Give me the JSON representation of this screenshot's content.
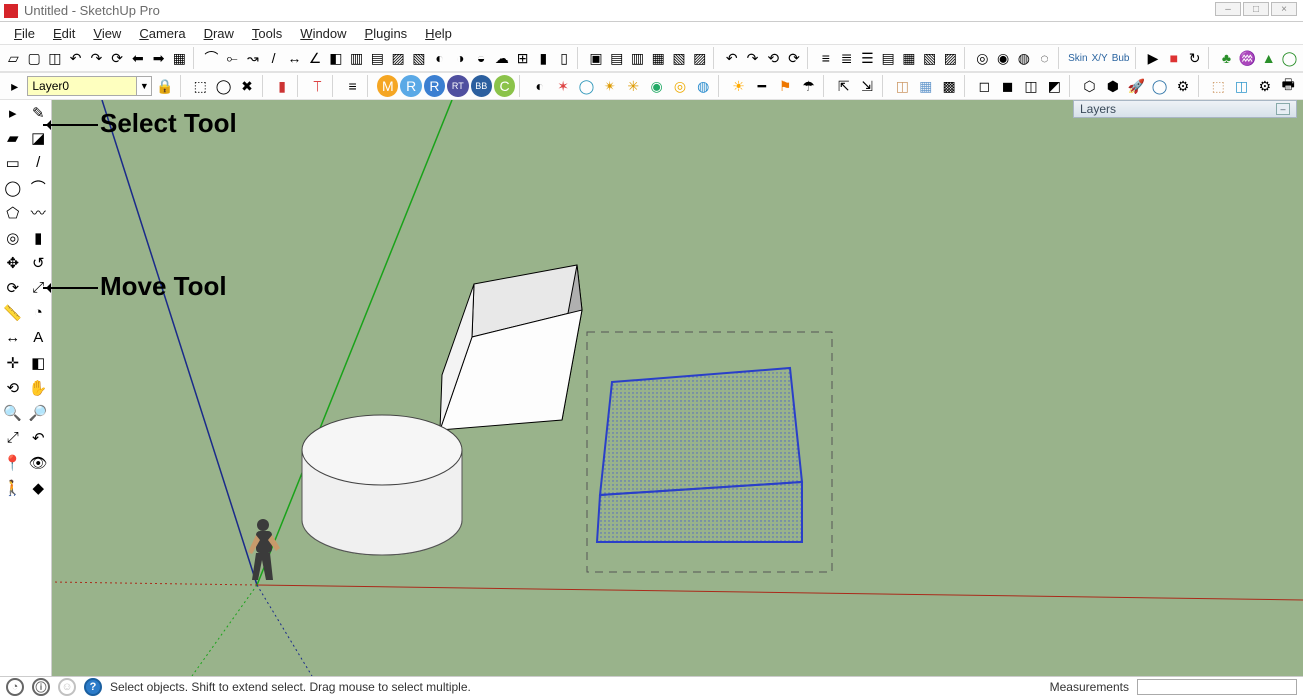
{
  "window": {
    "title": "Untitled - SketchUp Pro",
    "buttons": {
      "min": "–",
      "max": "□",
      "close": "×"
    }
  },
  "menu": [
    "File",
    "Edit",
    "View",
    "Camera",
    "Draw",
    "Tools",
    "Window",
    "Plugins",
    "Help"
  ],
  "layer_field": {
    "value": "Layer0"
  },
  "layers_panel": {
    "title": "Layers"
  },
  "status": {
    "hint": "Select objects. Shift to extend select. Drag mouse to select multiple.",
    "measurements_label": "Measurements",
    "measurements_value": ""
  },
  "annotations": {
    "select_tool": "Select Tool",
    "move_tool": "Move Tool"
  },
  "toolbar_row1_labels": [
    "Skin",
    "X/Y",
    "Bub"
  ],
  "left_tools": [
    [
      "select-tool",
      "▸",
      "make-component-tool",
      "✎"
    ],
    [
      "paint-bucket-tool",
      "▰",
      "eraser-tool",
      "◪"
    ],
    [
      "rectangle-tool",
      "▭",
      "line-tool",
      "/"
    ],
    [
      "circle-tool",
      "◯",
      "arc-tool",
      "⌒"
    ],
    [
      "polygon-tool",
      "⬠",
      "freehand-tool",
      "〰"
    ],
    [
      "offset-tool",
      "◎",
      "pushpull-tool",
      "▮"
    ],
    [
      "move-tool",
      "✥",
      "follow-me-tool",
      "↺"
    ],
    [
      "rotate-tool",
      "⟳",
      "scale-tool",
      "⤢"
    ],
    [
      "tape-measure-tool",
      "📏",
      "protractor-tool",
      "◔"
    ],
    [
      "dimension-tool",
      "↔",
      "text-tool",
      "A"
    ],
    [
      "axes-tool",
      "✛",
      "section-plane-tool",
      "◧"
    ],
    [
      "orbit-tool",
      "⟲",
      "pan-tool",
      "✋"
    ],
    [
      "zoom-tool",
      "🔍",
      "zoom-window-tool",
      "🔎"
    ],
    [
      "zoom-extents-tool",
      "⤢",
      "previous-view-tool",
      "↶"
    ],
    [
      "position-camera-tool",
      "📍",
      "look-around-tool",
      "👁"
    ],
    [
      "walk-tool",
      "🚶",
      "toggle-terrain-tool",
      "◆"
    ]
  ]
}
